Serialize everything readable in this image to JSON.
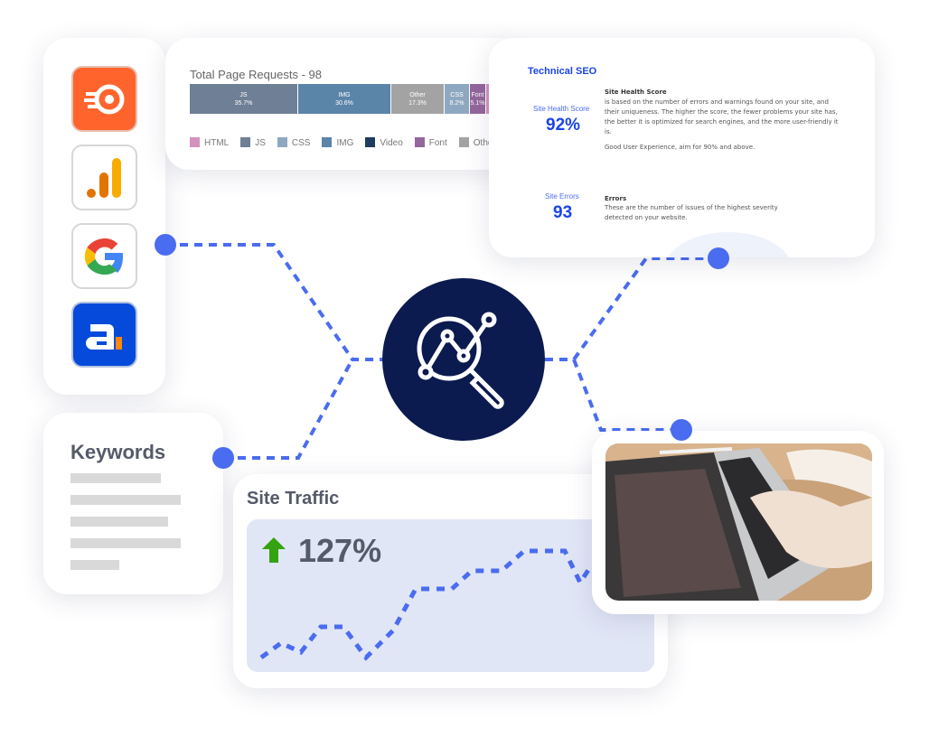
{
  "tools": [
    {
      "name": "semrush",
      "color": "#ff642d"
    },
    {
      "name": "google-analytics",
      "color": "#f9ab00"
    },
    {
      "name": "google",
      "color": "#4285f4"
    },
    {
      "name": "ahrefs-a",
      "color": "#054ada"
    }
  ],
  "page_requests": {
    "title": "Total Page Requests - 98",
    "segments": [
      {
        "label": "JS",
        "value": "35.7%",
        "color": "#6f7f95"
      },
      {
        "label": "IMG",
        "value": "30.6%",
        "color": "#5b84a9"
      },
      {
        "label": "Other",
        "value": "17.3%",
        "color": "#a3a3a3"
      },
      {
        "label": "CSS",
        "value": "8.2%",
        "color": "#8ea8c1"
      },
      {
        "label": "Font",
        "value": "5.1%",
        "color": "#94669c"
      },
      {
        "label": "",
        "value": "",
        "color": "#d491bc"
      }
    ],
    "legend": [
      {
        "label": "HTML",
        "color": "#d491bc"
      },
      {
        "label": "JS",
        "color": "#6f7f95"
      },
      {
        "label": "CSS",
        "color": "#8ea8c1"
      },
      {
        "label": "IMG",
        "color": "#5b84a9"
      },
      {
        "label": "Video",
        "color": "#1d3c60"
      },
      {
        "label": "Font",
        "color": "#94669c"
      },
      {
        "label": "Other",
        "color": "#a3a3a3"
      }
    ]
  },
  "technical_seo": {
    "title": "Technical SEO",
    "health_label": "Site Health Score",
    "health_value": "92%",
    "health_heading": "Site Health Score",
    "health_desc": " is based on the number of errors and warnings found on your site, and their uniqueness. The higher the score, the fewer problems your site has, the better it is optimized for search engines, and the more user-friendly it is.",
    "health_note": "Good User Experience, aim for 90% and above.",
    "errors_label": "Site Errors",
    "errors_value": "93",
    "errors_heading": "Errors",
    "errors_desc": "These are the number of issues of the highest severity detected on your website."
  },
  "keywords": {
    "title": "Keywords"
  },
  "traffic": {
    "title": "Site Traffic",
    "change": "127%",
    "trend": "up",
    "accent": "#4a6cf0"
  },
  "center_icon": "analytics-magnifier-icon",
  "colors": {
    "navy": "#0b1a4f",
    "accent": "#4a6cf0"
  }
}
